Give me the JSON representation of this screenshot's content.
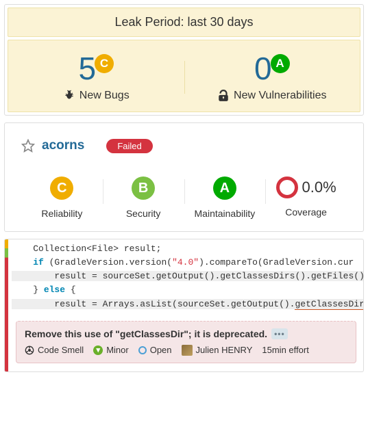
{
  "leak": {
    "header": "Leak Period: last 30 days",
    "bugs": {
      "count": "5",
      "grade": "C",
      "label": "New Bugs"
    },
    "vulns": {
      "count": "0",
      "grade": "A",
      "label": "New Vulnerabilities"
    }
  },
  "project": {
    "name": "acorns",
    "status": "Failed",
    "ratings": {
      "reliability": {
        "grade": "C",
        "label": "Reliability"
      },
      "security": {
        "grade": "B",
        "label": "Security"
      },
      "maintainability": {
        "grade": "A",
        "label": "Maintainability"
      }
    },
    "coverage": {
      "value": "0.0%",
      "label": "Coverage"
    }
  },
  "code": {
    "l1_a": "    Collection<File> result;",
    "l2_a": "    ",
    "l2_kw": "if",
    "l2_b": " (GradleVersion.version(",
    "l2_str": "\"4.0\"",
    "l2_c": ").compareTo(GradleVersion.cur",
    "l3_a": "        result = sourceSet.getOutput().getClassesDirs().getFiles()",
    "l4_a": "    } ",
    "l4_kw": "else",
    "l4_b": " {",
    "l5_a": "        result = Arrays.asList(sourceSet.getOutput().",
    "l5_u": "getClassesDir"
  },
  "issue": {
    "title": "Remove this use of \"getClassesDir\"; it is deprecated.",
    "type": "Code Smell",
    "severity": "Minor",
    "status": "Open",
    "author": "Julien HENRY",
    "effort": "15min effort"
  }
}
